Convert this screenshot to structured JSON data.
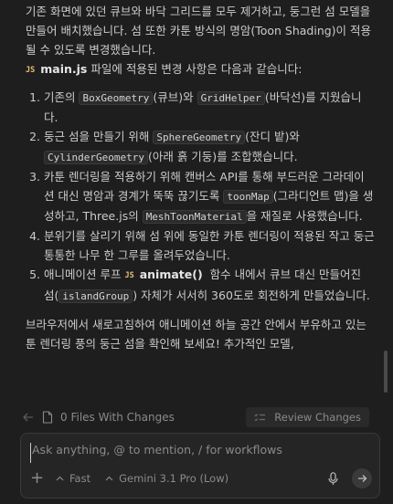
{
  "response": {
    "intro": "기존 화면에 있던 큐브와 바닥 그리드를 모두 제거하고, 둥그런 섬 모델을 만들어 배치했습니다. 섬 또한 카툰 방식의 명암(Toon Shading)이 적용될 수 있도록 변경했습니다.",
    "file_badge": "JS",
    "file_name": "main.js",
    "file_suffix": "파일에 적용된 변경 사항은 다음과 같습니다:",
    "items": [
      {
        "t1": "기존의 ",
        "c1": "BoxGeometry",
        "t2": "(큐브)와 ",
        "c2": "GridHelper",
        "t3": "(바닥선)를 지웠습니다."
      },
      {
        "t1": "둥근 섬을 만들기 위해 ",
        "c1": "SphereGeometry",
        "t2": "(잔디 밭)와 ",
        "c2": "CylinderGeometry",
        "t3": "(아래 흙 기둥)를 조합했습니다."
      },
      {
        "t1": "카툰 렌더링을 적용하기 위해 캔버스 API를 통해 부드러운 그라데이션 대신 명암과 경계가 뚝뚝 끊기도록 ",
        "c1": "toonMap",
        "t2": "(그라디언트 맵)을 생성하고, Three.js의 ",
        "c2": "MeshToonMaterial",
        "t3": "을 재질로 사용했습니다."
      },
      {
        "t1": "분위기를 살리기 위해 섬 위에 동일한 카툰 렌더링이 적용된 작고 둥근 통통한 나무 한 그루를 올려두었습니다."
      }
    ],
    "item5": {
      "t1": "애니메이션 루프 ",
      "badge": "JS",
      "fn": "animate()",
      "t2": "함수 내에서 큐브 대신 만들어진 섬(",
      "code": "islandGroup",
      "t3": ") 자체가 서서히 360도로 회전하게 만들었습니다."
    },
    "outro": "브라우저에서 새로고침하여 애니메이션 하늘 공간 안에서 부유하고 있는 툰 렌더링 풍의 둥근 섬을 확인해 보세요! 추가적인 모델,"
  },
  "changes_bar": {
    "files_label": "0 Files With Changes",
    "review_label": "Review Changes"
  },
  "input": {
    "placeholder": "Ask anything, @ to mention, / for workflows",
    "mode_label": "Fast",
    "model_label": "Gemini 3.1 Pro (Low)"
  }
}
